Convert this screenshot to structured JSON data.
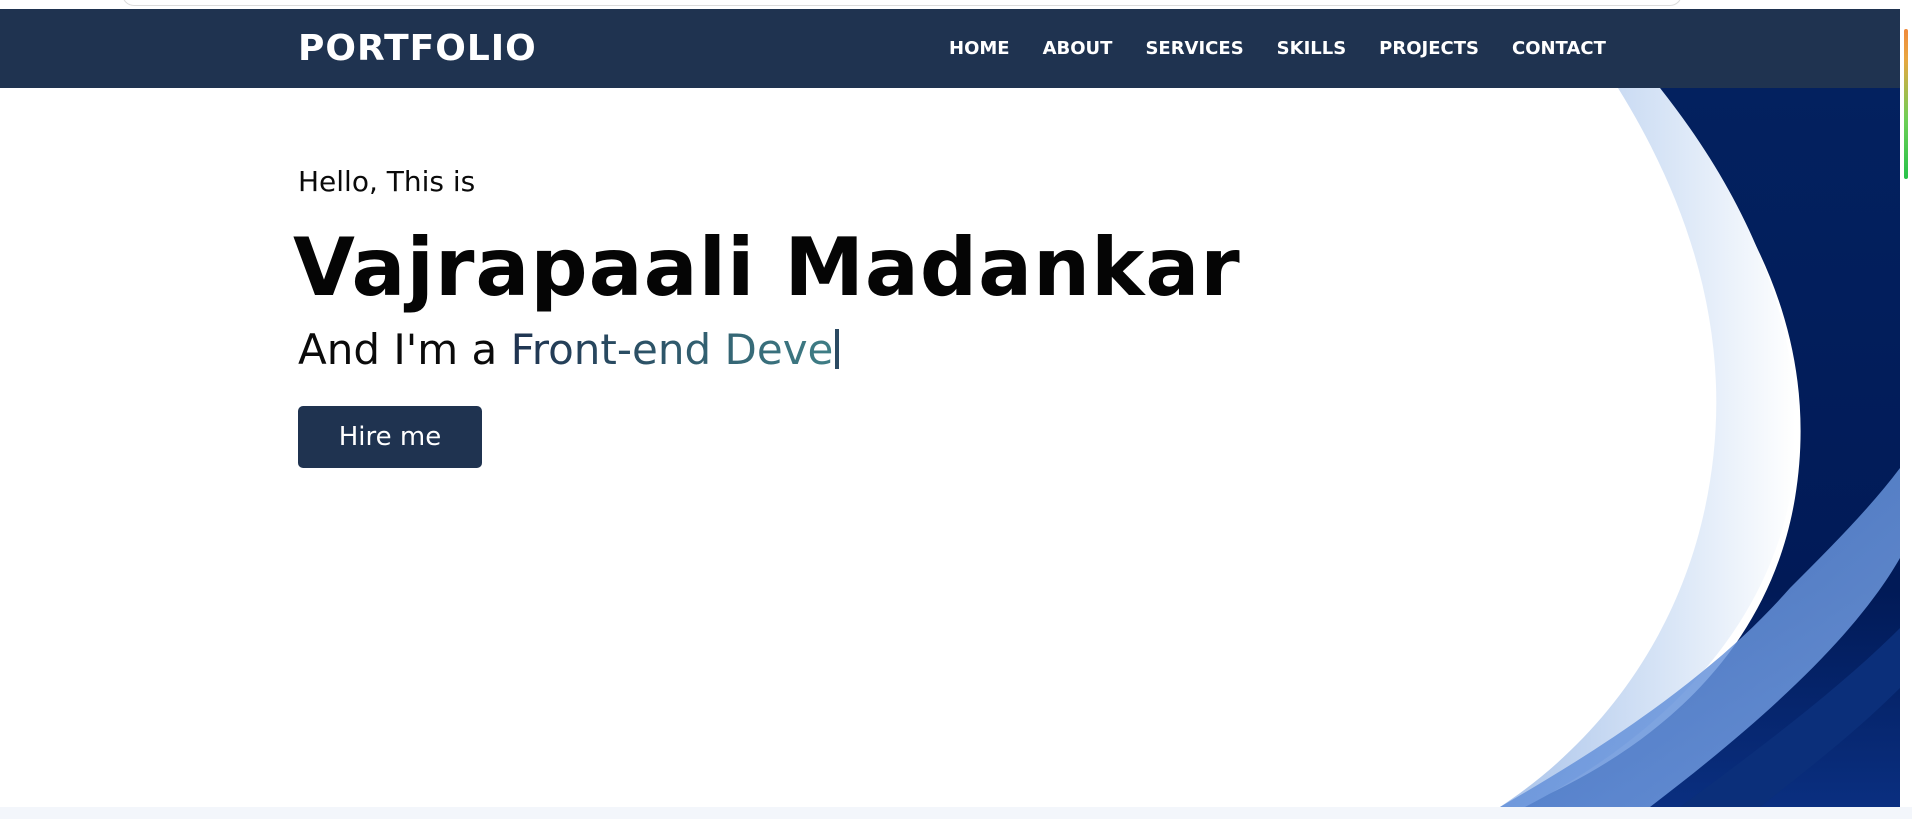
{
  "navbar": {
    "brand": "PORTFOLIO",
    "links": [
      {
        "label": "HOME"
      },
      {
        "label": "ABOUT"
      },
      {
        "label": "SERVICES"
      },
      {
        "label": "SKILLS"
      },
      {
        "label": "PROJECTS"
      },
      {
        "label": "CONTACT"
      }
    ]
  },
  "hero": {
    "greeting": "Hello, This is",
    "name": "Vajrapaali Madankar",
    "role_prefix": "And I'm a ",
    "role_typed": "Front-end Deve",
    "hire_label": "Hire me"
  },
  "colors": {
    "navbar_bg": "#1f3350",
    "accent_dark": "#1f3350",
    "accent_teal": "#3f7e86",
    "wave_navy": "#022266",
    "wave_light": "#c9daf2"
  }
}
